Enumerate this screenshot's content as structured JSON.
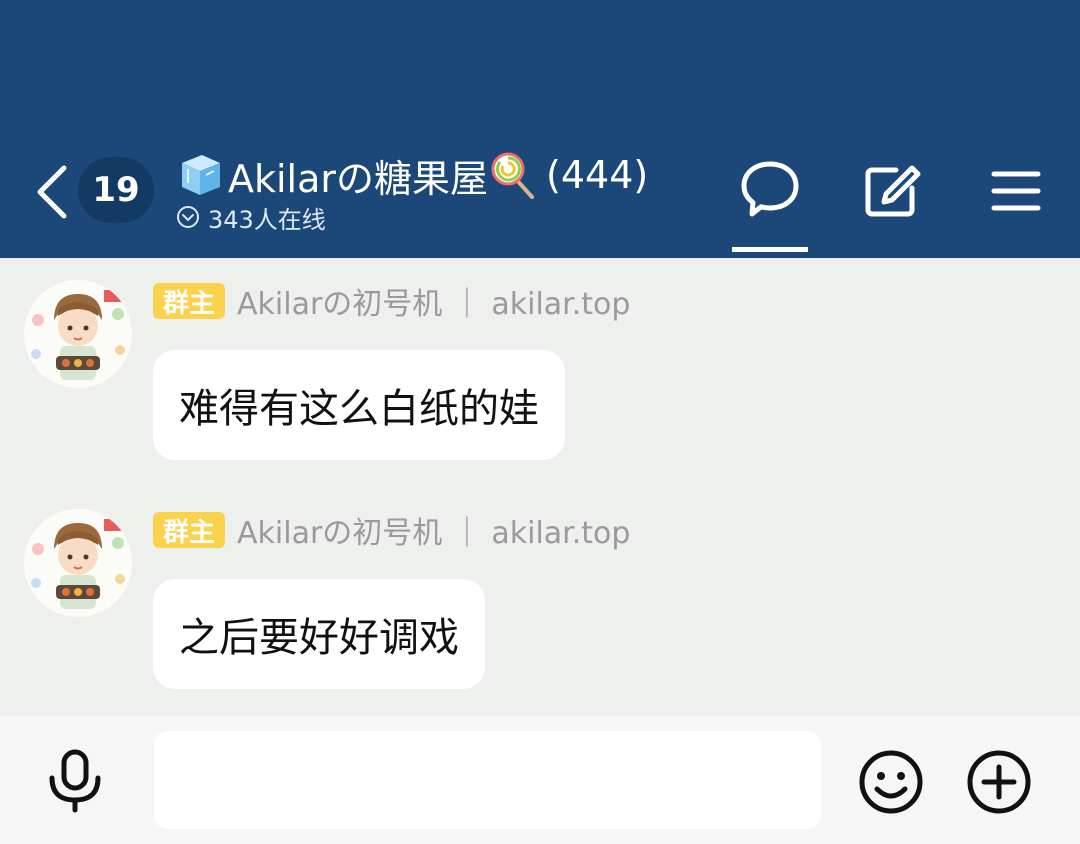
{
  "header": {
    "unread_count": "19",
    "group_name": "Akilarの糖果屋",
    "member_count": "(444)",
    "online_status": "343人在线",
    "icons": {
      "back": "chevron-left-icon",
      "title_prefix": "ice-cube-icon",
      "title_suffix": "lollipop-icon",
      "online": "circle-chevron-down-icon",
      "chat": "chat-bubble-icon",
      "edit": "edit-icon",
      "menu": "hamburger-menu-icon"
    }
  },
  "messages": [
    {
      "role": "群主",
      "sender": "Akilarの初号机 ｜ akilar.top",
      "text": "难得有这么白纸的娃"
    },
    {
      "role": "群主",
      "sender": "Akilarの初号机 ｜ akilar.top",
      "text": "之后要好好调戏"
    }
  ],
  "input": {
    "value": "",
    "placeholder": "",
    "icons": {
      "voice": "microphone-icon",
      "emoji": "smiley-icon",
      "more": "plus-circle-icon"
    }
  },
  "colors": {
    "header_bg": "#1b4878",
    "chat_bg": "#eef0ed",
    "role_badge": "#fbd24c",
    "bubble_bg": "#ffffff"
  }
}
